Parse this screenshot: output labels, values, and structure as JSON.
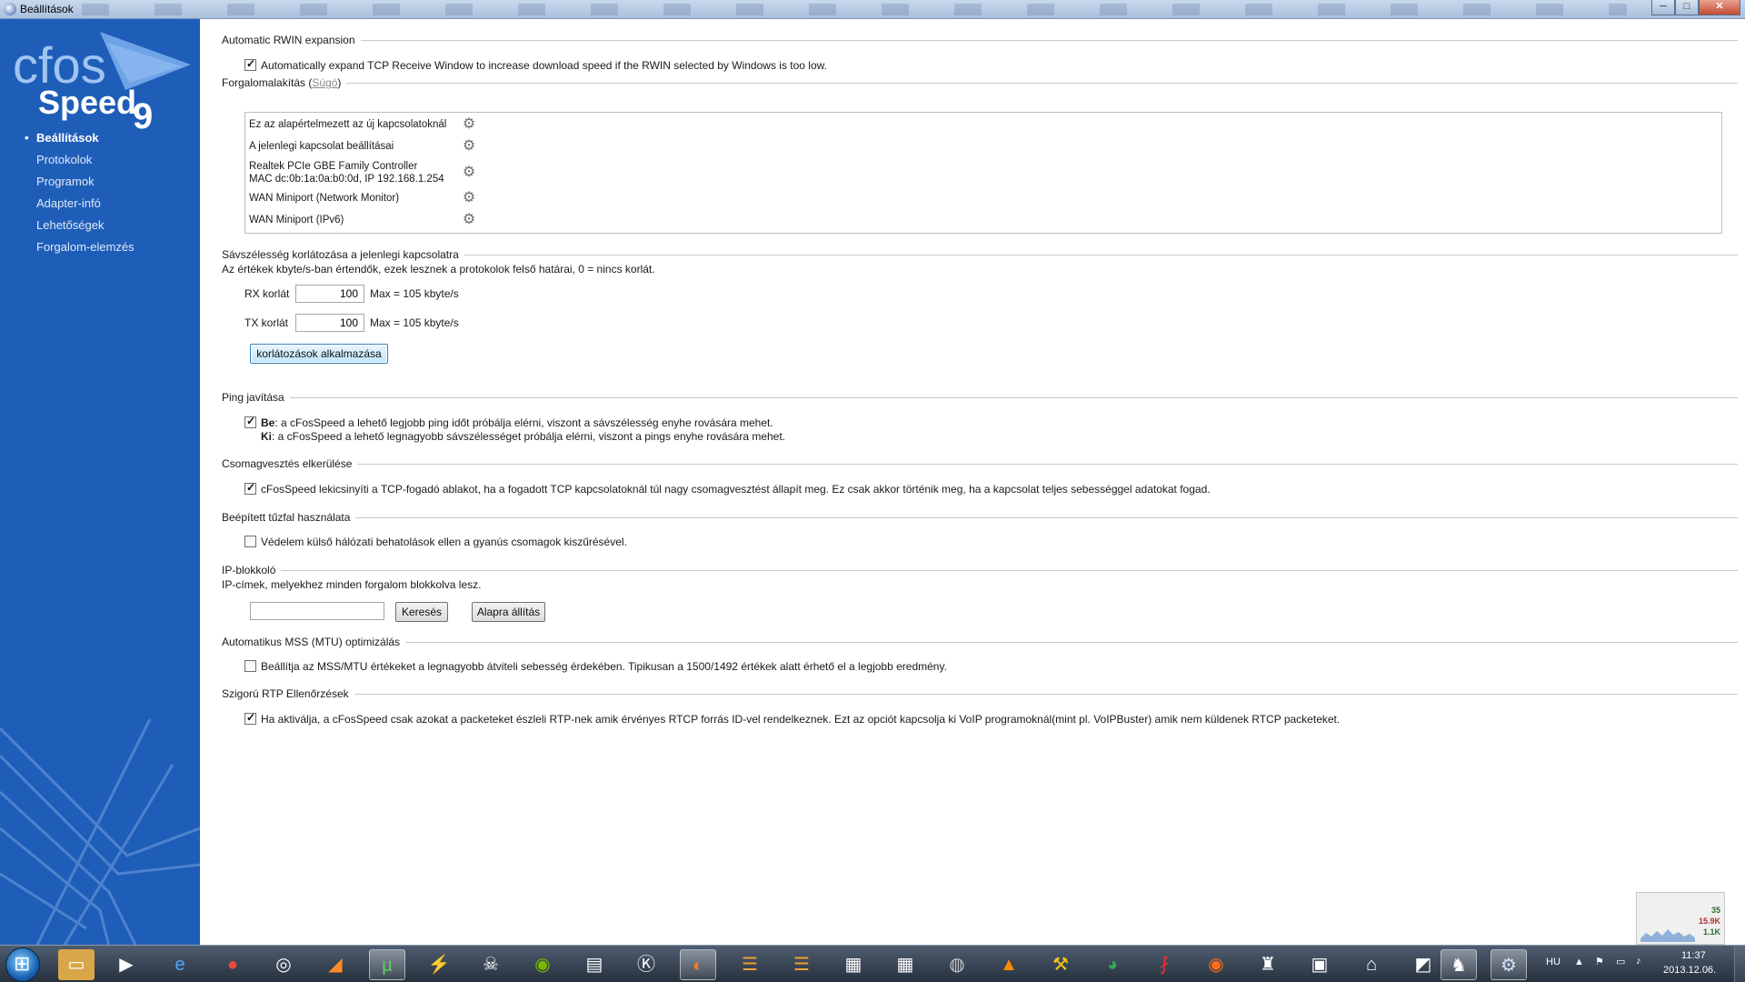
{
  "window": {
    "title": "Beállítások",
    "min_symbol": "─",
    "max_symbol": "□",
    "close_symbol": "✕"
  },
  "logo": {
    "line1": "cfos",
    "line2": "Speed",
    "version": "9"
  },
  "sidebar": {
    "items": [
      {
        "label": "Beállítások",
        "active": true
      },
      {
        "label": "Protokolok"
      },
      {
        "label": "Programok"
      },
      {
        "label": "Adapter-infó"
      },
      {
        "label": "Lehetőségek"
      },
      {
        "label": "Forgalom-elemzés"
      }
    ]
  },
  "rwin": {
    "title": "Automatic RWIN expansion",
    "checkbox_label": "Automatically expand TCP Receive Window to increase download speed if the RWIN selected by Windows is too low.",
    "checked": true
  },
  "shaping": {
    "title": "Forgalomalakítás",
    "help_paren_open": "(",
    "help_link": "Súgó",
    "help_paren_close": ")",
    "profiles": [
      {
        "line1": "Ez az alapértelmezett az új kapcsolatoknál"
      },
      {
        "line1": "A jelenlegi kapcsolat beállításai"
      },
      {
        "line1": "Realtek PCIe GBE Family Controller",
        "line2": "MAC dc:0b:1a:0a:b0:0d, IP 192.168.1.254"
      },
      {
        "line1": "WAN Miniport (Network Monitor)"
      },
      {
        "line1": "WAN Miniport (IPv6)"
      }
    ],
    "gear_glyph": "⚙"
  },
  "bandwidth": {
    "title": "Sávszélesség korlátozása a jelenlegi kapcsolatra",
    "description": "Az értékek kbyte/s-ban értendők, ezek lesznek a protokolok felső határai, 0 = nincs korlát.",
    "rx_label": "RX korlát",
    "rx_value": "100",
    "rx_max": "Max = 105 kbyte/s",
    "tx_label": "TX korlát",
    "tx_value": "100",
    "tx_max": "Max = 105 kbyte/s",
    "apply_button": "korlátozások alkalmazása"
  },
  "ping": {
    "title": "Ping javítása",
    "checked": true,
    "on_label": "Be",
    "on_text": ": a cFosSpeed a lehető legjobb ping időt próbálja elérni, viszont a sávszélesség enyhe rovására mehet.",
    "off_label": "Ki",
    "off_text": ": a cFosSpeed a lehető legnagyobb sávszélességet próbálja elérni, viszont a pings enyhe rovására mehet."
  },
  "packetloss": {
    "title": "Csomagvesztés elkerülése",
    "checked": true,
    "checkbox_label": "cFosSpeed lekicsinyíti a TCP-fogadó ablakot, ha a fogadott TCP kapcsolatoknál túl nagy csomagvesztést állapít meg. Ez csak akkor történik meg, ha a kapcsolat teljes sebességgel adatokat fogad."
  },
  "firewall": {
    "title": "Beépített tűzfal használata",
    "checked": false,
    "checkbox_label": "Védelem külső hálózati behatolások ellen a gyanús csomagok kiszűrésével."
  },
  "ipblock": {
    "title": "IP-blokkoló",
    "description": "IP-címek, melyekhez minden forgalom blokkolva lesz.",
    "input_value": "",
    "search_button": "Keresés",
    "reset_button": "Alapra állítás"
  },
  "mss": {
    "title": "Automatikus MSS (MTU) optimizálás",
    "checked": false,
    "checkbox_label": "Beállítja az MSS/MTU értékeket a legnagyobb átviteli sebesség érdekében. Tipikusan a 1500/1492 értékek alatt érhető el a legjobb eredmény."
  },
  "rtp": {
    "title": "Szigorú RTP Ellenőrzések",
    "checked": true,
    "checkbox_label": "Ha aktiválja, a cFosSpeed csak azokat a packeteket észleli RTP-nek amik érvényes RTCP forrás ID-vel rendelkeznek. Ezt az opciót kapcsolja ki VoIP programoknál(mint pl. VoIPBuster) amik nem küldenek RTCP packeteket."
  },
  "net_widget": {
    "v1": "35",
    "v2": "15.9K",
    "v3": "1.1K",
    "color": "#2d6a2d"
  },
  "taskbar": {
    "icons": [
      "explorer-icon",
      "media-player-icon",
      "internet-explorer-icon",
      "app-red-icon",
      "steam-icon",
      "origin-icon",
      "utorrent-icon",
      "app-blue-icon",
      "alienware-icon",
      "nvidia-icon",
      "notepad-icon",
      "k-icon",
      "firefox-icon",
      "app-orange1-icon",
      "app-orange2-icon",
      "document1-icon",
      "document2-icon",
      "cd-icon",
      "vlc-icon",
      "hammer-icon",
      "chrome-icon",
      "adobe-reader-icon",
      "origin2-icon",
      "game1-icon",
      "video-icon",
      "batman-icon",
      "game2-icon",
      "game3-icon",
      "cfos-active-icon"
    ],
    "language": "HU",
    "time": "11:37",
    "date": "2013.12.06."
  },
  "colors": {
    "sidebar_bg": "#1f5eb8",
    "accent": "#3c7fb1"
  }
}
